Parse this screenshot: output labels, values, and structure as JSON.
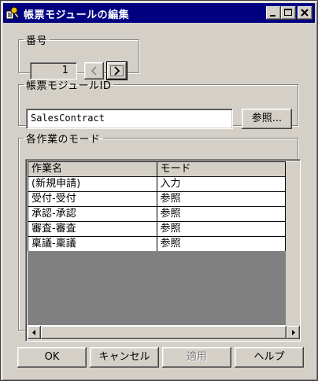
{
  "window": {
    "title": "帳票モジュールの編集"
  },
  "number_group": {
    "legend": "番号",
    "value": "1",
    "prev_icon": "chevron-left-icon",
    "next_icon": "chevron-right-icon"
  },
  "module_id_group": {
    "legend": "帳票モジュールID",
    "value": "SalesContract",
    "browse_label": "参照..."
  },
  "mode_group": {
    "legend": "各作業のモード",
    "columns": [
      "作業名",
      "モード"
    ],
    "rows": [
      {
        "task": "(新規申請)",
        "mode": "入力"
      },
      {
        "task": "受付-受付",
        "mode": "参照"
      },
      {
        "task": "承認-承認",
        "mode": "参照"
      },
      {
        "task": "審査-審査",
        "mode": "参照"
      },
      {
        "task": "稟議-稟議",
        "mode": "参照"
      }
    ]
  },
  "buttons": {
    "ok": "OK",
    "cancel": "キャンセル",
    "apply": "適用",
    "help": "ヘルプ"
  },
  "colors": {
    "titlebar": "#000080",
    "face": "#d4d0c8",
    "empty_grid": "#808080"
  }
}
